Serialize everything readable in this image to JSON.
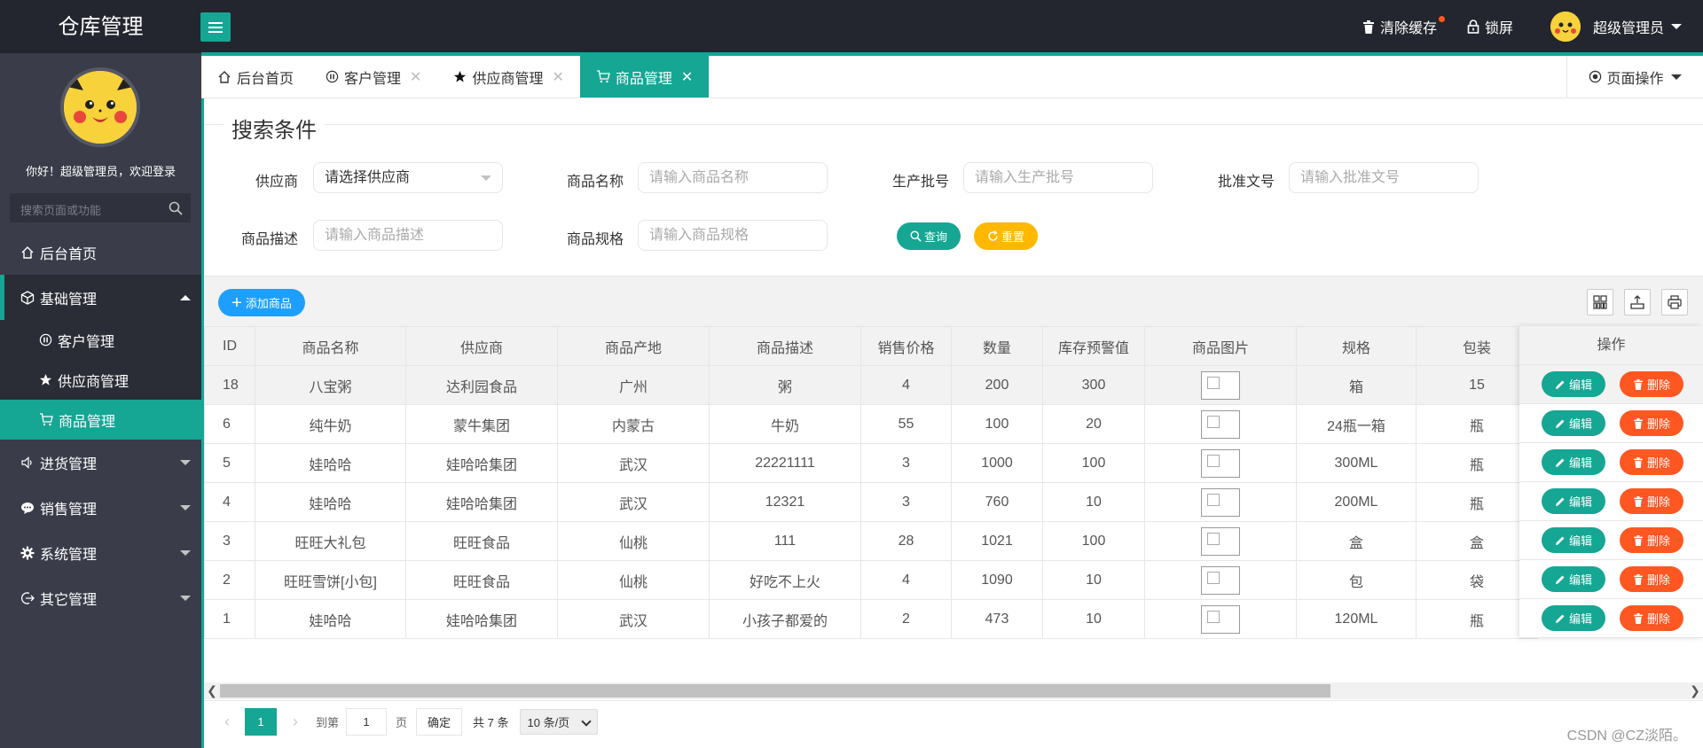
{
  "app": {
    "title": "仓库管理"
  },
  "header": {
    "clear_cache": "清除缓存",
    "lock": "锁屏",
    "user": "超级管理员"
  },
  "sidebar": {
    "welcome": "你好！超级管理员，欢迎登录",
    "search_placeholder": "搜索页面或功能",
    "items": {
      "home": "后台首页",
      "basic": "基础管理",
      "customer": "客户管理",
      "supplier": "供应商管理",
      "goods": "商品管理",
      "purchase": "进货管理",
      "sales": "销售管理",
      "system": "系统管理",
      "other": "其它管理"
    }
  },
  "tabs": {
    "home": "后台首页",
    "customer": "客户管理",
    "supplier": "供应商管理",
    "goods": "商品管理",
    "page_ops": "页面操作"
  },
  "search": {
    "title": "搜索条件",
    "supplier_label": "供应商",
    "supplier_value": "请选择供应商",
    "name_label": "商品名称",
    "name_placeholder": "请输入商品名称",
    "batch_label": "生产批号",
    "batch_placeholder": "请输入生产批号",
    "approval_label": "批准文号",
    "approval_placeholder": "请输入批准文号",
    "desc_label": "商品描述",
    "desc_placeholder": "请输入商品描述",
    "spec_label": "商品规格",
    "spec_placeholder": "请输入商品规格",
    "query_btn": "查询",
    "reset_btn": "重置"
  },
  "toolbar": {
    "add_btn": "添加商品"
  },
  "table": {
    "headers": {
      "id": "ID",
      "name": "商品名称",
      "supplier": "供应商",
      "origin": "商品产地",
      "desc": "商品描述",
      "price": "销售价格",
      "qty": "数量",
      "warn": "库存预警值",
      "image": "商品图片",
      "spec": "规格",
      "pack": "包装",
      "ops": "操作"
    },
    "rows": [
      {
        "id": "18",
        "name": "八宝粥",
        "supplier": "达利园食品",
        "origin": "广州",
        "desc": "粥",
        "price": "4",
        "qty": "200",
        "warn": "300",
        "spec": "箱",
        "pack": "15"
      },
      {
        "id": "6",
        "name": "纯牛奶",
        "supplier": "蒙牛集团",
        "origin": "内蒙古",
        "desc": "牛奶",
        "price": "55",
        "qty": "100",
        "warn": "20",
        "spec": "24瓶一箱",
        "pack": "瓶"
      },
      {
        "id": "5",
        "name": "娃哈哈",
        "supplier": "娃哈哈集团",
        "origin": "武汉",
        "desc": "22221111",
        "price": "3",
        "qty": "1000",
        "warn": "100",
        "spec": "300ML",
        "pack": "瓶"
      },
      {
        "id": "4",
        "name": "娃哈哈",
        "supplier": "娃哈哈集团",
        "origin": "武汉",
        "desc": "12321",
        "price": "3",
        "qty": "760",
        "warn": "10",
        "spec": "200ML",
        "pack": "瓶"
      },
      {
        "id": "3",
        "name": "旺旺大礼包",
        "supplier": "旺旺食品",
        "origin": "仙桃",
        "desc": "111",
        "price": "28",
        "qty": "1021",
        "warn": "100",
        "spec": "盒",
        "pack": "盒"
      },
      {
        "id": "2",
        "name": "旺旺雪饼[小包]",
        "supplier": "旺旺食品",
        "origin": "仙桃",
        "desc": "好吃不上火",
        "price": "4",
        "qty": "1090",
        "warn": "10",
        "spec": "包",
        "pack": "袋"
      },
      {
        "id": "1",
        "name": "娃哈哈",
        "supplier": "娃哈哈集团",
        "origin": "武汉",
        "desc": "小孩子都爱的",
        "price": "2",
        "qty": "473",
        "warn": "10",
        "spec": "120ML",
        "pack": "瓶"
      }
    ],
    "edit_btn": "编辑",
    "delete_btn": "删除"
  },
  "pager": {
    "current": "1",
    "goto_label": "到第",
    "goto_value": "1",
    "page_label": "页",
    "ok_btn": "确定",
    "total": "共 7 条",
    "page_size": "10 条/页"
  },
  "watermark": "CSDN @CZ淡陌。",
  "colors": {
    "accent": "#16a694",
    "topbar": "#23262e",
    "sidebar": "#3a3d49",
    "danger": "#ff5722",
    "warning": "#ffb800",
    "primary": "#1e9fff"
  }
}
